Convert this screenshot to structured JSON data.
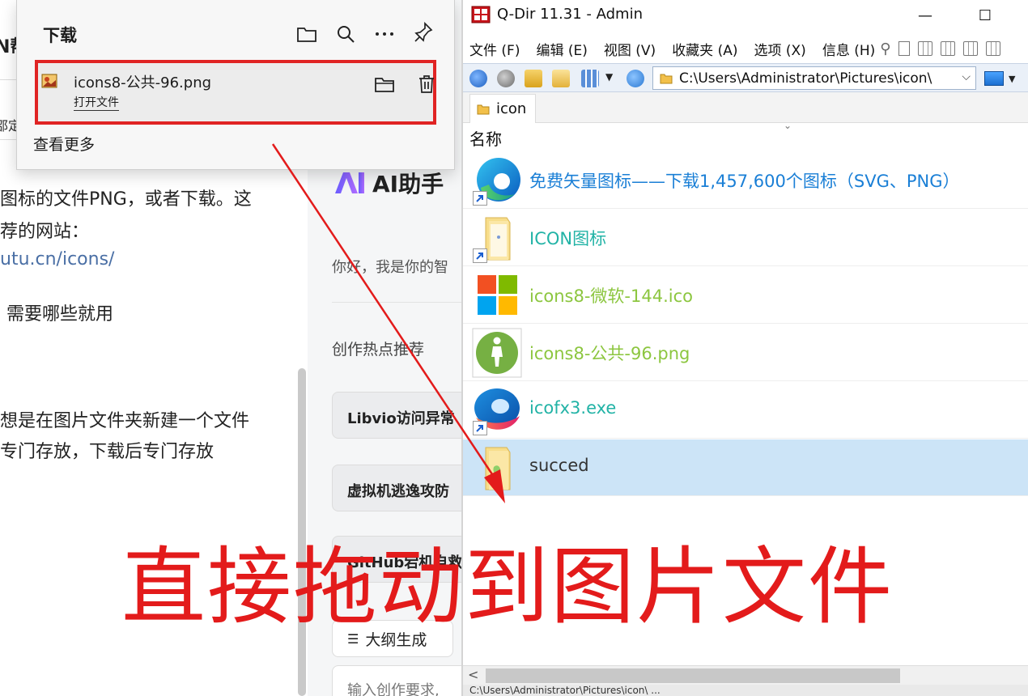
{
  "browser": {
    "site_title_fragment": "N帮",
    "nav_fragment": "邵定",
    "article": {
      "line1": "图标的文件PNG，或者下载。这",
      "line2": "荐的网站：",
      "line3_link": "utu.cn/icons/",
      "line4": "需要哪些就用",
      "line5": "想是在图片文件夹新建一个文件",
      "line6": "专门存放，下载后专门存放"
    },
    "ai_panel": {
      "title": "AI助手",
      "greeting": "你好，我是你的智",
      "hot_title": "创作热点推荐",
      "hot_items": [
        "Libvio访问异常",
        "虚拟机逃逸攻防",
        "GitHub宕机自救"
      ],
      "outline_button": "大纲生成",
      "input_placeholder": "输入创作要求,"
    }
  },
  "download_panel": {
    "title": "下载",
    "toolbar": [
      "folder-icon",
      "search-icon",
      "more-icon",
      "pin-icon"
    ],
    "item": {
      "file_name": "icons8-公共-96.png",
      "open_label": "打开文件"
    },
    "see_more": "查看更多"
  },
  "qdir": {
    "title": "Q-Dir 11.31 - Admin",
    "minimize_label": "—",
    "maximize_label": "☐",
    "menu": [
      "文件 (F)",
      "编辑 (E)",
      "视图 (V)",
      "收藏夹 (A)",
      "选项 (X)",
      "信息 (H)"
    ],
    "address": "C:\\Users\\Administrator\\Pictures\\icon\\",
    "tab_label": "icon",
    "column_name": "名称",
    "status_text": "C:\\Users\\Administrator\\Pictures\\icon\\ ...",
    "files": [
      {
        "name": "免费矢量图标——下载1,457,600个图标（SVG、PNG）",
        "color": "#1a7fd6",
        "icon": "edge-shortcut-icon",
        "shortcut": true,
        "selected": false
      },
      {
        "name": "ICON图标",
        "color": "#22b3a6",
        "icon": "folder-shortcut-icon",
        "shortcut": true,
        "selected": false
      },
      {
        "name": "icons8-微软-144.ico",
        "color": "#8cc63f",
        "icon": "microsoft-logo-icon",
        "shortcut": false,
        "selected": false
      },
      {
        "name": "icons8-公共-96.png",
        "color": "#8cc63f",
        "icon": "pedestrian-icon",
        "shortcut": false,
        "selected": false
      },
      {
        "name": "icofx3.exe",
        "color": "#22b3a6",
        "icon": "icofx-app-icon",
        "shortcut": true,
        "selected": false
      },
      {
        "name": "succed",
        "color": "#333333",
        "icon": "folder-icon",
        "shortcut": false,
        "selected": true
      }
    ]
  },
  "annotation": {
    "caption": "直接拖动到图片文件",
    "color": "#e31b1b"
  }
}
